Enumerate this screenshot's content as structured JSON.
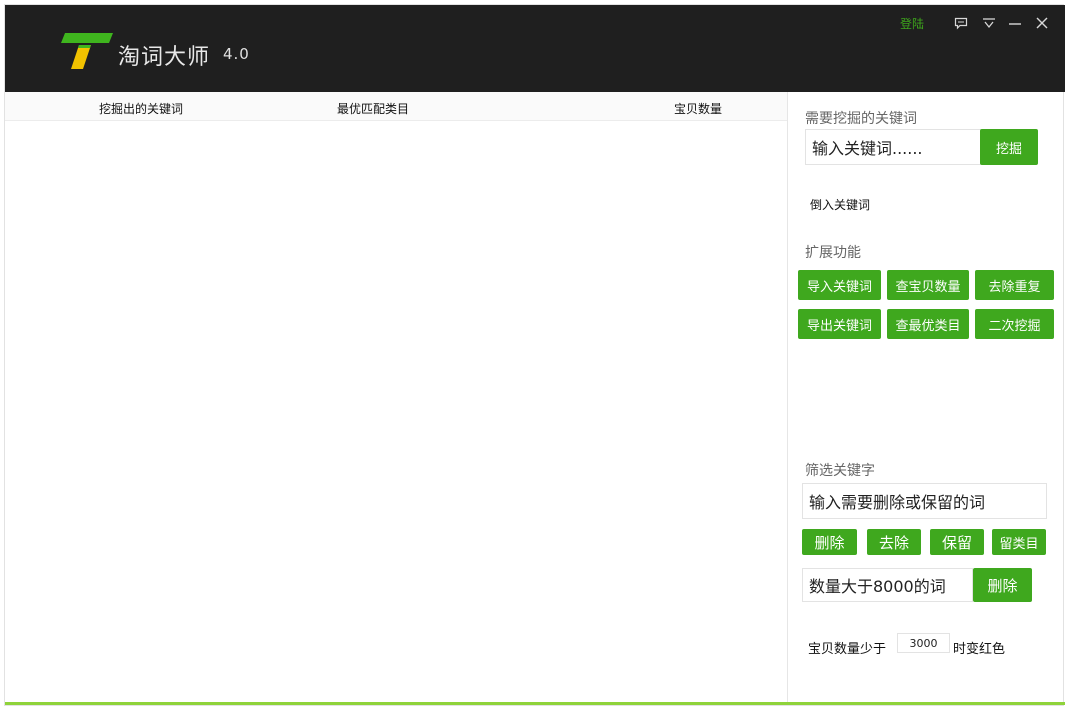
{
  "header": {
    "app_title": "淘词大师",
    "version": "4.0",
    "login_label": "登陆"
  },
  "table": {
    "columns": [
      "挖掘出的关键词",
      "最优匹配类目",
      "宝贝数量"
    ],
    "rows": []
  },
  "mine_section": {
    "label": "需要挖掘的关键词",
    "input_value": "输入关键词......",
    "mine_button": "挖掘",
    "import_link": "倒入关键词"
  },
  "extend_section": {
    "label": "扩展功能",
    "buttons": [
      "导入关键词",
      "查宝贝数量",
      "去除重复",
      "导出关键词",
      "查最优类目",
      "二次挖掘"
    ]
  },
  "filter_section": {
    "label": "筛选关键字",
    "input_value": "输入需要删除或保留的词",
    "buttons": [
      "删除",
      "去除",
      "保留",
      "留类目"
    ],
    "quantity_input": "数量大于8000的词",
    "quantity_delete_button": "删除",
    "threshold_prefix": "宝贝数量少于",
    "threshold_value": "3000",
    "threshold_suffix": "时变红色"
  },
  "colors": {
    "title_bar": "#1f1f1f",
    "accent_green": "#3fa81e",
    "bottom_bar": "#8fd33a",
    "logo_green": "#3fb51e",
    "logo_yellow": "#f2c200"
  },
  "icons": [
    "logo-icon",
    "feedback-icon",
    "menu-dropdown-icon",
    "minimize-icon",
    "close-icon"
  ]
}
